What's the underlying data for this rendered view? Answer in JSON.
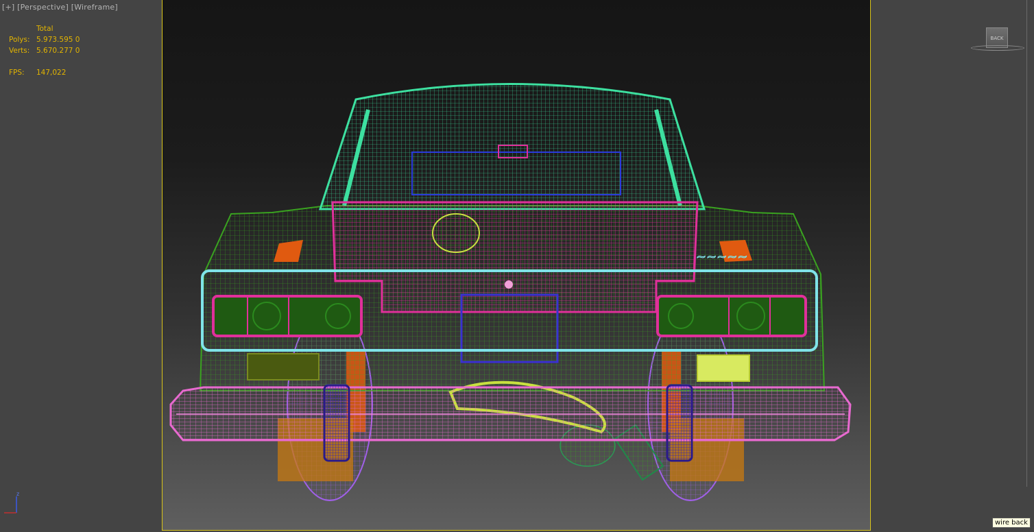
{
  "viewport": {
    "label_plus": "[+]",
    "label_view": "[Perspective]",
    "label_mode": "[Wireframe]"
  },
  "stats": {
    "header": "Total",
    "polys_label": "Polys:",
    "polys_value": "5.973.595 0",
    "verts_label": "Verts:",
    "verts_value": "5.670.277 0",
    "fps_label": "FPS:",
    "fps_value": "147,022"
  },
  "viewcube": {
    "face_label": "BACK"
  },
  "tooltip": {
    "text": "wire back"
  },
  "axis": {
    "z_label": "z"
  },
  "colors": {
    "stats_text": "#e2b400",
    "frame_border": "#d9c419",
    "body_green": "#3aa320",
    "roof_mint": "#3de0a0",
    "magenta": "#e0309a",
    "pink_bumper": "#e86ad0",
    "cyan_trim": "#7fe3e8",
    "purple_wheel": "#a060e8",
    "orange": "#e05a10",
    "yellow_green": "#c8e040",
    "navy": "#2a1a8a"
  }
}
